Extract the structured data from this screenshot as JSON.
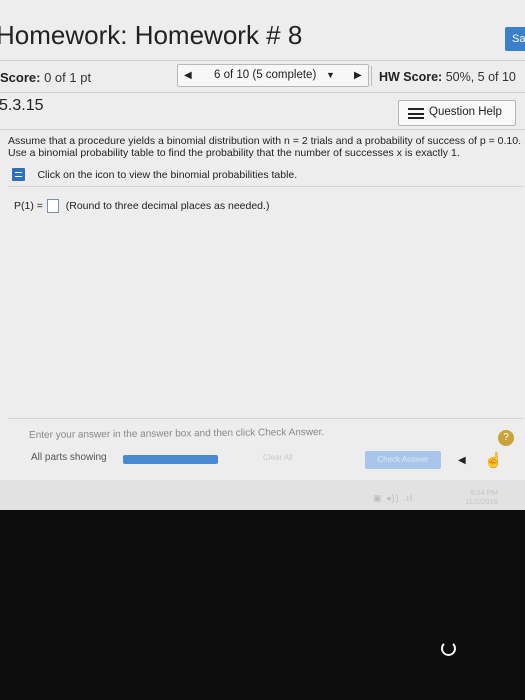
{
  "header": {
    "title": "Homework: Homework # 8",
    "save_label": "Sa"
  },
  "score_bar": {
    "score_label": "Score:",
    "score_value": "0 of 1 pt",
    "nav_text": "6 of 10 (5 complete)",
    "hw_score_label": "HW Score:",
    "hw_score_value": "50%, 5 of 10"
  },
  "question": {
    "number": "5.3.15",
    "help_label": "Question Help",
    "line1": "Assume that a procedure yields a binomial distribution with n = 2 trials and a probability of success of p = 0.10.",
    "line2": "Use a binomial probability table to find the probability that the number of successes x is exactly 1.",
    "table_link": "Click on the icon to view the binomial probabilities table.",
    "answer_label": "P(1) =",
    "answer_value": "",
    "answer_note": "(Round to three decimal places as needed.)"
  },
  "footer": {
    "instruction": "Enter your answer in the answer box and then click Check Answer.",
    "help_mark": "?",
    "parts_label": "All parts showing",
    "clear_all_label": "Clear All",
    "check_answer_label": "Check Answer"
  },
  "taskbar": {
    "time": "9:24 PM",
    "date": "11/2/2016"
  },
  "colors": {
    "accent": "#3a7fc8",
    "progress": "#4a88d0"
  }
}
